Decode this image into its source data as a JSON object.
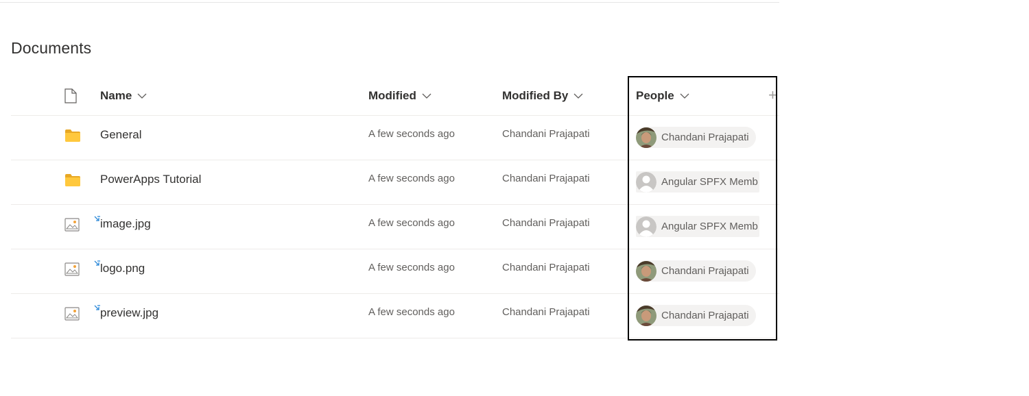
{
  "page_title": "Documents",
  "columns": {
    "type_icon": "document-icon",
    "name": "Name",
    "modified": "Modified",
    "modified_by": "Modified By",
    "people": "People",
    "add_column": "+"
  },
  "rows": [
    {
      "icon": "folder-icon",
      "name": "General",
      "modified": "A few seconds ago",
      "modified_by": "Chandani Prajapati",
      "people": "Chandani Prajapati",
      "people_avatar": "photo",
      "new": false
    },
    {
      "icon": "folder-icon",
      "name": "PowerApps Tutorial",
      "modified": "A few seconds ago",
      "modified_by": "Chandani Prajapati",
      "people": "Angular SPFX Memb",
      "people_avatar": "placeholder",
      "new": false
    },
    {
      "icon": "image-file-icon",
      "name": "image.jpg",
      "modified": "A few seconds ago",
      "modified_by": "Chandani Prajapati",
      "people": "Angular SPFX Memb",
      "people_avatar": "placeholder",
      "new": true
    },
    {
      "icon": "image-file-icon",
      "name": "logo.png",
      "modified": "A few seconds ago",
      "modified_by": "Chandani Prajapati",
      "people": "Chandani Prajapati",
      "people_avatar": "photo",
      "new": true
    },
    {
      "icon": "image-file-icon",
      "name": "preview.jpg",
      "modified": "A few seconds ago",
      "modified_by": "Chandani Prajapati",
      "people": "Chandani Prajapati",
      "people_avatar": "photo",
      "new": true
    }
  ],
  "colors": {
    "folder": "#ffc83d",
    "new_marker": "#2b88d8",
    "highlight_border": "#000000"
  }
}
